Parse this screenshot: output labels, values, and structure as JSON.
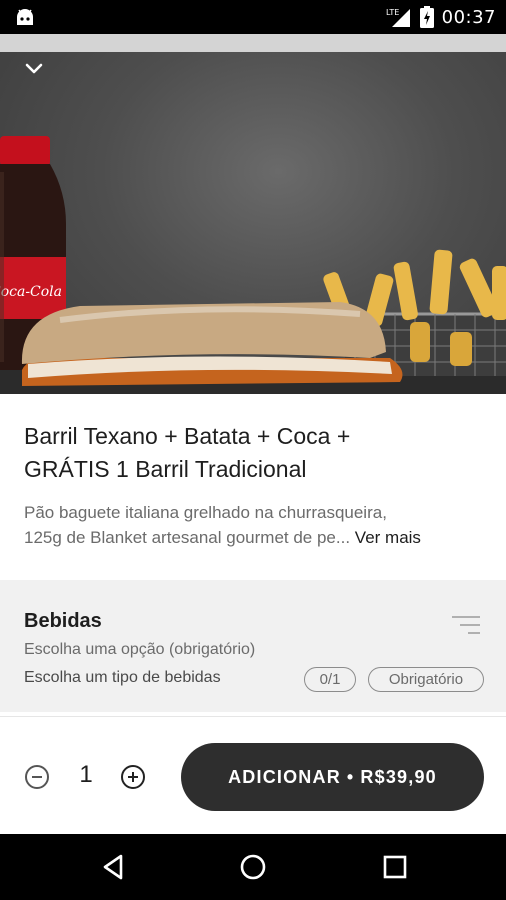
{
  "status_bar": {
    "time": "00:37",
    "network": "LTE",
    "icons": [
      "android-icon",
      "signal-icon",
      "battery-icon"
    ]
  },
  "hero": {
    "back_icon": "chevron-down-icon",
    "bottle_label": "Coca-Cola"
  },
  "product": {
    "title_line1": "Barril Texano + Batata + Coca +",
    "title_line2": "GRÁTIS 1 Barril Tradicional",
    "desc_line1": "Pão baguete italiana grelhado na churrasqueira,",
    "desc_line2": "125g de Blanket artesanal gourmet de pe...",
    "see_more": "Ver mais"
  },
  "section": {
    "title": "Bebidas",
    "subtitle": "Escolha uma opção (obrigatório)",
    "hint": "Escolha um tipo de bebidas",
    "count_badge": "0/1",
    "required_badge": "Obrigatório",
    "filter_icon": "sort-lines-icon"
  },
  "bottom_bar": {
    "quantity": "1",
    "minus_icon": "minus-circle-icon",
    "plus_icon": "plus-circle-icon",
    "add_label": "ADICIONAR",
    "separator": "•",
    "price": "R$39,90"
  },
  "nav_bar": {
    "icons": [
      "back-triangle-icon",
      "home-circle-icon",
      "recents-square-icon"
    ]
  },
  "colors": {
    "button_bg": "#2e2e2e",
    "section_bg": "#f1f1f1",
    "text_primary": "#1e1e1e",
    "text_secondary": "#6b6b6b"
  }
}
